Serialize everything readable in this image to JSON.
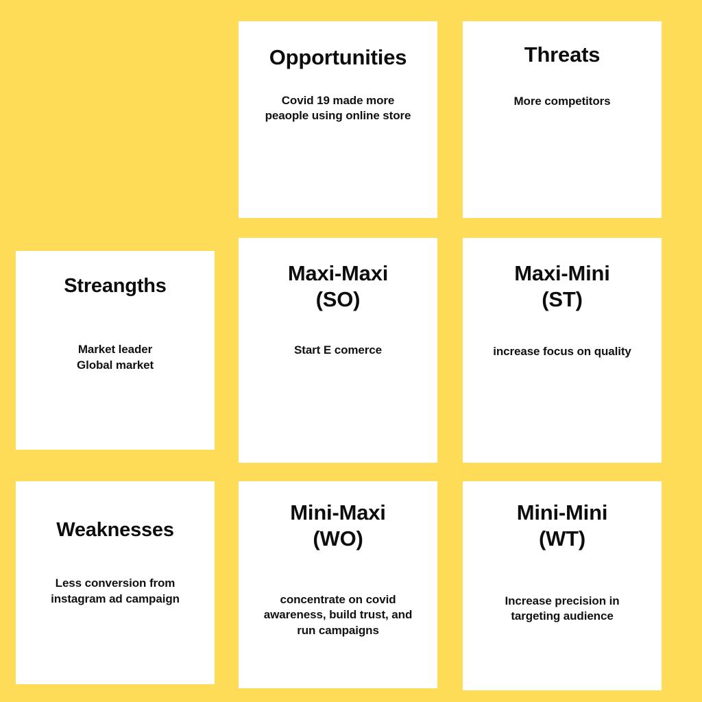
{
  "background_color": "#ffdc58",
  "card_color": "#ffffff",
  "text_color": "#111111",
  "matrix": {
    "type": "tows-matrix",
    "columns": 3,
    "rows": 3,
    "cells": [
      {
        "id": "corner-empty",
        "row": 1,
        "column": 1,
        "visible": false,
        "title": "",
        "body": ""
      },
      {
        "id": "opportunities",
        "row": 1,
        "column": 2,
        "visible": true,
        "kind": "external-factor",
        "title": "Opportunities",
        "body": "Covid 19 made more peaople using online store"
      },
      {
        "id": "threats",
        "row": 1,
        "column": 3,
        "visible": true,
        "kind": "external-factor",
        "title": "Threats",
        "body": "More competitors"
      },
      {
        "id": "strengths",
        "row": 2,
        "column": 1,
        "visible": true,
        "kind": "internal-factor",
        "title": "Streangths",
        "body": "Market leader\nGlobal market"
      },
      {
        "id": "maxi-maxi-so",
        "row": 2,
        "column": 2,
        "visible": true,
        "kind": "strategy",
        "title": "Maxi-Maxi\n(SO)",
        "body": "Start E comerce"
      },
      {
        "id": "maxi-mini-st",
        "row": 2,
        "column": 3,
        "visible": true,
        "kind": "strategy",
        "title": "Maxi-Mini\n(ST)",
        "body": "increase focus on quality"
      },
      {
        "id": "weaknesses",
        "row": 3,
        "column": 1,
        "visible": true,
        "kind": "internal-factor",
        "title": "Weaknesses",
        "body": "Less conversion from instagram ad campaign"
      },
      {
        "id": "mini-maxi-wo",
        "row": 3,
        "column": 2,
        "visible": true,
        "kind": "strategy",
        "title": "Mini-Maxi\n(WO)",
        "body": "concentrate on covid awareness, build trust, and run campaigns"
      },
      {
        "id": "mini-mini-wt",
        "row": 3,
        "column": 3,
        "visible": true,
        "kind": "strategy",
        "title": "Mini-Mini\n(WT)",
        "body": "Increase precision in targeting audience"
      }
    ]
  }
}
